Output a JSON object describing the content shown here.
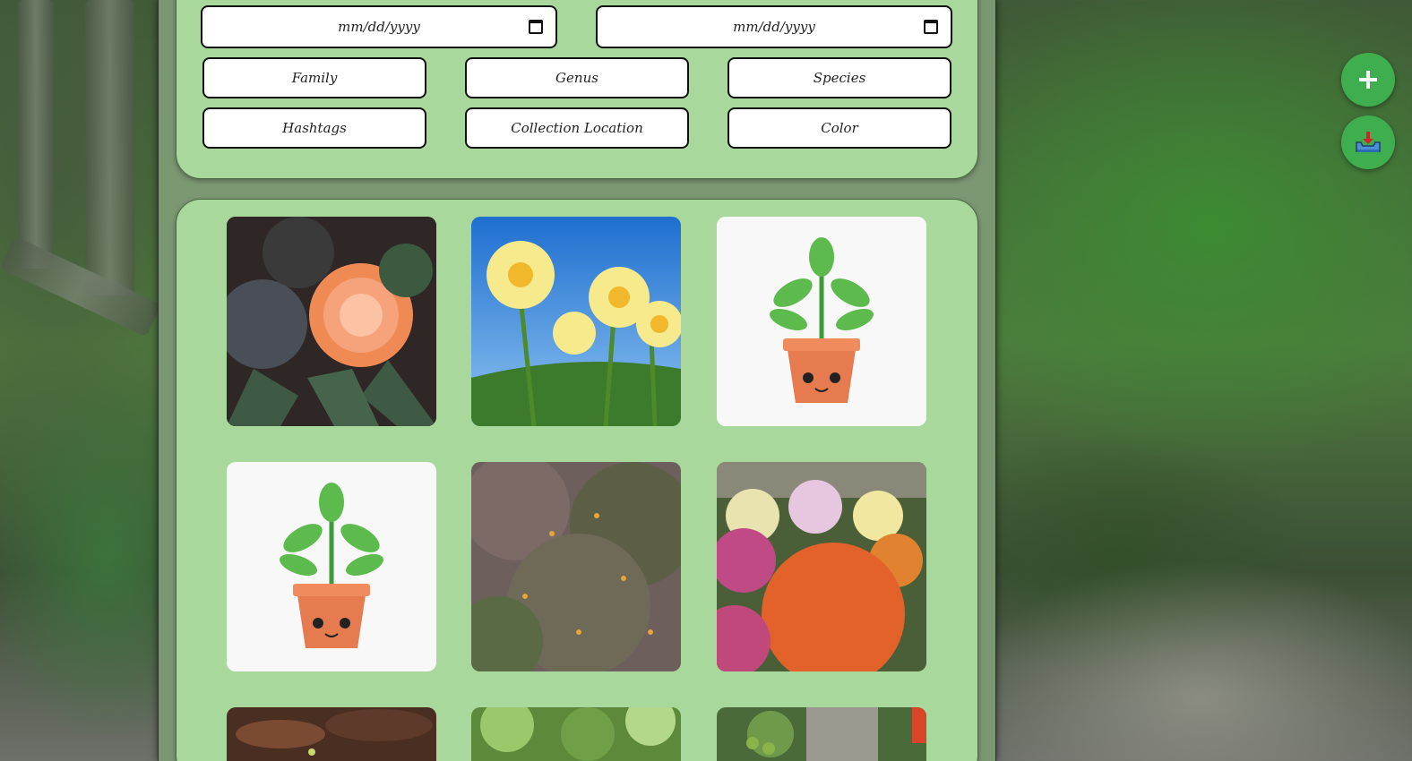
{
  "filters": {
    "date_start": {
      "placeholder": "mm/dd/yyyy"
    },
    "date_end": {
      "placeholder": "mm/dd/yyyy"
    },
    "buttons": [
      {
        "label": "Family"
      },
      {
        "label": "Genus"
      },
      {
        "label": "Species"
      },
      {
        "label": "Hashtags"
      },
      {
        "label": "Collection Location"
      },
      {
        "label": "Color"
      }
    ]
  },
  "gallery": {
    "items": [
      {
        "image": "frosted-orange-flower"
      },
      {
        "image": "yellow-daffodils"
      },
      {
        "image": "placeholder-potted-plant"
      },
      {
        "image": "placeholder-potted-plant"
      },
      {
        "image": "wild-shrub"
      },
      {
        "image": "chrysanthemum-garden"
      },
      {
        "image": "leaf-litter"
      },
      {
        "image": "green-foliage"
      },
      {
        "image": "tomato-plant"
      }
    ]
  },
  "actions": {
    "add_icon": "plus-icon",
    "download_icon": "inbox-tray-icon"
  },
  "colors": {
    "panel": "#a8d89c",
    "fab": "#3fae4f"
  }
}
